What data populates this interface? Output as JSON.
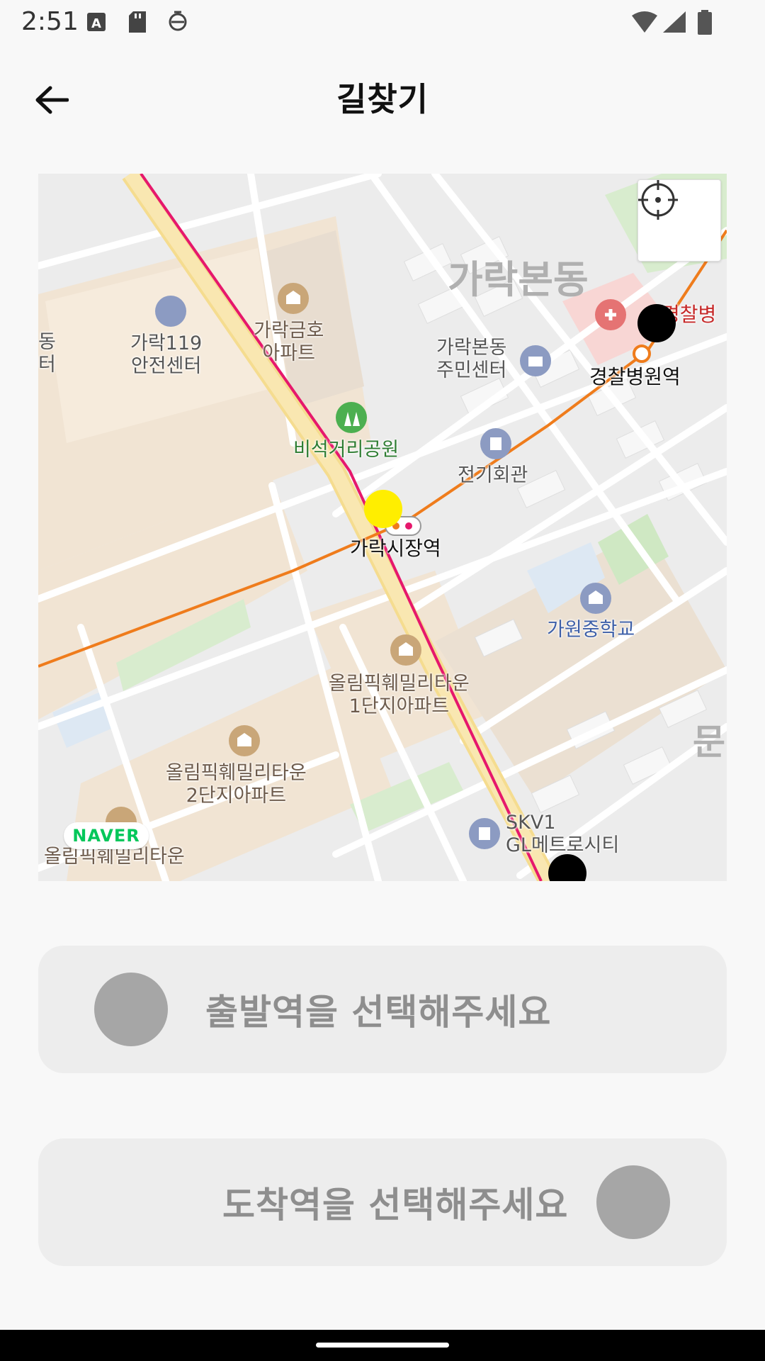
{
  "status_bar": {
    "time": "2:51"
  },
  "header": {
    "title": "길찾기"
  },
  "map": {
    "area_label": "가락본동",
    "labels": {
      "garak119": "가락119\n안전센터",
      "garak_geumho": "가락금호\n아파트",
      "garakbon_center": "가락본동\n주민센터",
      "park": "비석거리공원",
      "electric_hall": "전기회관",
      "garak_market_station": "가락시장역",
      "police_hospital_station": "경찰병원역",
      "police_hospital": "경찰병",
      "gawon_school": "가원중학교",
      "olympic1": "올림픽훼밀리타운\n1단지아파트",
      "olympic2": "올림픽훼밀리타운\n2단지아파트",
      "olympic3": "올림픽훼밀리타운",
      "skv1": "SKV1\nGL메트로시티",
      "left_edge": "동\n터",
      "right_edge": "문"
    },
    "provider": "NAVER",
    "colors": {
      "current_marker": "#ffee00",
      "station_marker": "#000000",
      "line3": "#ef7c1c",
      "line8": "#e6186c"
    }
  },
  "departure": {
    "placeholder": "출발역을 선택해주세요"
  },
  "arrival": {
    "placeholder": "도착역을 선택해주세요"
  }
}
